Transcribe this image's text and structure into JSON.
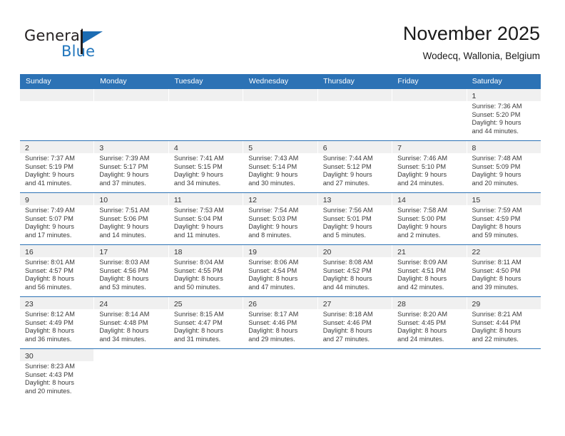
{
  "brand": {
    "name_top": "General",
    "name_bottom": "Blue",
    "accent_color": "#2176bd"
  },
  "header": {
    "title": "November 2025",
    "subtitle": "Wodecq, Wallonia, Belgium"
  },
  "calendar": {
    "header_color": "#2c72b5",
    "weekdays": [
      "Sunday",
      "Monday",
      "Tuesday",
      "Wednesday",
      "Thursday",
      "Friday",
      "Saturday"
    ],
    "weeks": [
      [
        {
          "day": "",
          "empty": true
        },
        {
          "day": "",
          "empty": true
        },
        {
          "day": "",
          "empty": true
        },
        {
          "day": "",
          "empty": true
        },
        {
          "day": "",
          "empty": true
        },
        {
          "day": "",
          "empty": true
        },
        {
          "day": "1",
          "sunrise": "Sunrise: 7:36 AM",
          "sunset": "Sunset: 5:20 PM",
          "daylight1": "Daylight: 9 hours",
          "daylight2": "and 44 minutes."
        }
      ],
      [
        {
          "day": "2",
          "sunrise": "Sunrise: 7:37 AM",
          "sunset": "Sunset: 5:19 PM",
          "daylight1": "Daylight: 9 hours",
          "daylight2": "and 41 minutes."
        },
        {
          "day": "3",
          "sunrise": "Sunrise: 7:39 AM",
          "sunset": "Sunset: 5:17 PM",
          "daylight1": "Daylight: 9 hours",
          "daylight2": "and 37 minutes."
        },
        {
          "day": "4",
          "sunrise": "Sunrise: 7:41 AM",
          "sunset": "Sunset: 5:15 PM",
          "daylight1": "Daylight: 9 hours",
          "daylight2": "and 34 minutes."
        },
        {
          "day": "5",
          "sunrise": "Sunrise: 7:43 AM",
          "sunset": "Sunset: 5:14 PM",
          "daylight1": "Daylight: 9 hours",
          "daylight2": "and 30 minutes."
        },
        {
          "day": "6",
          "sunrise": "Sunrise: 7:44 AM",
          "sunset": "Sunset: 5:12 PM",
          "daylight1": "Daylight: 9 hours",
          "daylight2": "and 27 minutes."
        },
        {
          "day": "7",
          "sunrise": "Sunrise: 7:46 AM",
          "sunset": "Sunset: 5:10 PM",
          "daylight1": "Daylight: 9 hours",
          "daylight2": "and 24 minutes."
        },
        {
          "day": "8",
          "sunrise": "Sunrise: 7:48 AM",
          "sunset": "Sunset: 5:09 PM",
          "daylight1": "Daylight: 9 hours",
          "daylight2": "and 20 minutes."
        }
      ],
      [
        {
          "day": "9",
          "sunrise": "Sunrise: 7:49 AM",
          "sunset": "Sunset: 5:07 PM",
          "daylight1": "Daylight: 9 hours",
          "daylight2": "and 17 minutes."
        },
        {
          "day": "10",
          "sunrise": "Sunrise: 7:51 AM",
          "sunset": "Sunset: 5:06 PM",
          "daylight1": "Daylight: 9 hours",
          "daylight2": "and 14 minutes."
        },
        {
          "day": "11",
          "sunrise": "Sunrise: 7:53 AM",
          "sunset": "Sunset: 5:04 PM",
          "daylight1": "Daylight: 9 hours",
          "daylight2": "and 11 minutes."
        },
        {
          "day": "12",
          "sunrise": "Sunrise: 7:54 AM",
          "sunset": "Sunset: 5:03 PM",
          "daylight1": "Daylight: 9 hours",
          "daylight2": "and 8 minutes."
        },
        {
          "day": "13",
          "sunrise": "Sunrise: 7:56 AM",
          "sunset": "Sunset: 5:01 PM",
          "daylight1": "Daylight: 9 hours",
          "daylight2": "and 5 minutes."
        },
        {
          "day": "14",
          "sunrise": "Sunrise: 7:58 AM",
          "sunset": "Sunset: 5:00 PM",
          "daylight1": "Daylight: 9 hours",
          "daylight2": "and 2 minutes."
        },
        {
          "day": "15",
          "sunrise": "Sunrise: 7:59 AM",
          "sunset": "Sunset: 4:59 PM",
          "daylight1": "Daylight: 8 hours",
          "daylight2": "and 59 minutes."
        }
      ],
      [
        {
          "day": "16",
          "sunrise": "Sunrise: 8:01 AM",
          "sunset": "Sunset: 4:57 PM",
          "daylight1": "Daylight: 8 hours",
          "daylight2": "and 56 minutes."
        },
        {
          "day": "17",
          "sunrise": "Sunrise: 8:03 AM",
          "sunset": "Sunset: 4:56 PM",
          "daylight1": "Daylight: 8 hours",
          "daylight2": "and 53 minutes."
        },
        {
          "day": "18",
          "sunrise": "Sunrise: 8:04 AM",
          "sunset": "Sunset: 4:55 PM",
          "daylight1": "Daylight: 8 hours",
          "daylight2": "and 50 minutes."
        },
        {
          "day": "19",
          "sunrise": "Sunrise: 8:06 AM",
          "sunset": "Sunset: 4:54 PM",
          "daylight1": "Daylight: 8 hours",
          "daylight2": "and 47 minutes."
        },
        {
          "day": "20",
          "sunrise": "Sunrise: 8:08 AM",
          "sunset": "Sunset: 4:52 PM",
          "daylight1": "Daylight: 8 hours",
          "daylight2": "and 44 minutes."
        },
        {
          "day": "21",
          "sunrise": "Sunrise: 8:09 AM",
          "sunset": "Sunset: 4:51 PM",
          "daylight1": "Daylight: 8 hours",
          "daylight2": "and 42 minutes."
        },
        {
          "day": "22",
          "sunrise": "Sunrise: 8:11 AM",
          "sunset": "Sunset: 4:50 PM",
          "daylight1": "Daylight: 8 hours",
          "daylight2": "and 39 minutes."
        }
      ],
      [
        {
          "day": "23",
          "sunrise": "Sunrise: 8:12 AM",
          "sunset": "Sunset: 4:49 PM",
          "daylight1": "Daylight: 8 hours",
          "daylight2": "and 36 minutes."
        },
        {
          "day": "24",
          "sunrise": "Sunrise: 8:14 AM",
          "sunset": "Sunset: 4:48 PM",
          "daylight1": "Daylight: 8 hours",
          "daylight2": "and 34 minutes."
        },
        {
          "day": "25",
          "sunrise": "Sunrise: 8:15 AM",
          "sunset": "Sunset: 4:47 PM",
          "daylight1": "Daylight: 8 hours",
          "daylight2": "and 31 minutes."
        },
        {
          "day": "26",
          "sunrise": "Sunrise: 8:17 AM",
          "sunset": "Sunset: 4:46 PM",
          "daylight1": "Daylight: 8 hours",
          "daylight2": "and 29 minutes."
        },
        {
          "day": "27",
          "sunrise": "Sunrise: 8:18 AM",
          "sunset": "Sunset: 4:46 PM",
          "daylight1": "Daylight: 8 hours",
          "daylight2": "and 27 minutes."
        },
        {
          "day": "28",
          "sunrise": "Sunrise: 8:20 AM",
          "sunset": "Sunset: 4:45 PM",
          "daylight1": "Daylight: 8 hours",
          "daylight2": "and 24 minutes."
        },
        {
          "day": "29",
          "sunrise": "Sunrise: 8:21 AM",
          "sunset": "Sunset: 4:44 PM",
          "daylight1": "Daylight: 8 hours",
          "daylight2": "and 22 minutes."
        }
      ],
      [
        {
          "day": "30",
          "sunrise": "Sunrise: 8:23 AM",
          "sunset": "Sunset: 4:43 PM",
          "daylight1": "Daylight: 8 hours",
          "daylight2": "and 20 minutes."
        },
        {
          "day": "",
          "blank": true
        },
        {
          "day": "",
          "blank": true
        },
        {
          "day": "",
          "blank": true
        },
        {
          "day": "",
          "blank": true
        },
        {
          "day": "",
          "blank": true
        },
        {
          "day": "",
          "blank": true
        }
      ]
    ]
  }
}
